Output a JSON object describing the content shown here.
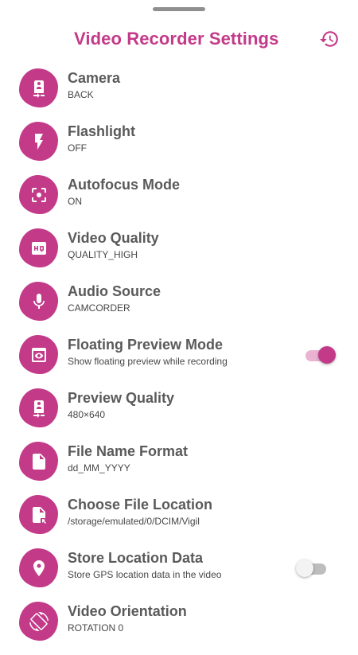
{
  "header": {
    "title": "Video Recorder Settings",
    "history_icon": "history-icon"
  },
  "colors": {
    "accent": "#c33a89",
    "accent_light": "#eab3d2",
    "text_primary": "#5a5a5a",
    "text_secondary": "#474747"
  },
  "settings": [
    {
      "label": "Camera",
      "value": "BACK",
      "icon": "camera-switch-icon"
    },
    {
      "label": "Flashlight",
      "value": "OFF",
      "icon": "flash-icon"
    },
    {
      "label": "Autofocus Mode",
      "value": "ON",
      "icon": "focus-icon"
    },
    {
      "label": "Video Quality",
      "value": "QUALITY_HIGH",
      "icon": "hq-icon"
    },
    {
      "label": "Audio Source",
      "value": "CAMCORDER",
      "icon": "microphone-icon"
    },
    {
      "label": "Floating Preview Mode",
      "value": "Show floating preview while recording",
      "icon": "preview-eye-icon",
      "toggle": true
    },
    {
      "label": "Preview Quality",
      "value": "480×640",
      "icon": "camera-switch-icon"
    },
    {
      "label": "File Name Format",
      "value": "dd_MM_YYYY",
      "icon": "file-icon"
    },
    {
      "label": "Choose File Location",
      "value": "/storage/emulated/0/DCIM/Vigil",
      "icon": "file-location-icon"
    },
    {
      "label": "Store Location Data",
      "value": "Store GPS location data in the video",
      "icon": "location-pin-icon",
      "toggle": false
    },
    {
      "label": "Video Orientation",
      "value": "ROTATION 0",
      "icon": "rotation-icon"
    }
  ]
}
